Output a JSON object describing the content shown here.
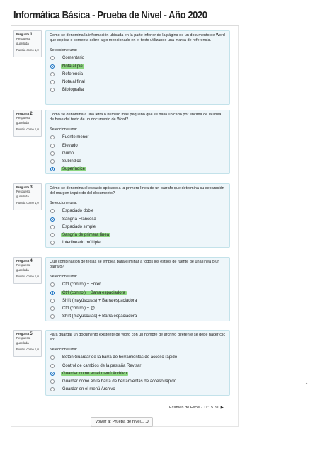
{
  "page": {
    "title": "Informática Básica - Prueba de Nivel - Año 2020"
  },
  "questions": [
    {
      "number_label": "Pregunta",
      "number": "1",
      "status": "Respuesta guardada",
      "score": "Puntúa como 1,0",
      "text": "Como se denomina la información ubicada en la parte inferior de la página de un documento de Word que explica o comenta sobre algo mencionado en el texto utilizando una marca de referencia.",
      "prompt": "Seleccione una:",
      "options": [
        "Comentario",
        "Nota al pie",
        "Referencia",
        "Nota al final",
        "Bibliografía"
      ],
      "selected_index": 1,
      "highlighted_index": 1
    },
    {
      "number_label": "Pregunta",
      "number": "2",
      "status": "Respuesta guardada",
      "score": "Puntúa como 1,0",
      "text": "Cómo se denomina a una letra o número más pequeño que se halla ubicado por encima de la línea de base del texto de un documento de Word?",
      "prompt": "Seleccione una:",
      "options": [
        "Fuente menor",
        "Elevado",
        "Guion",
        "Subíndice",
        "Superíndice"
      ],
      "selected_index": 4,
      "highlighted_index": 4
    },
    {
      "number_label": "Pregunta",
      "number": "3",
      "status": "Respuesta guardada",
      "score": "Puntúa como 1,0",
      "text": "Cómo se denomina el espacio aplicado a la primera línea de un párrafo que determina su separación del margen izquierdo del documento?",
      "prompt": "Seleccione una:",
      "options": [
        "Espaciado doble",
        "Sangría Francesa",
        "Espaciado simple",
        "Sangría de primera línea",
        "Interlineado múltiple"
      ],
      "selected_index": 1,
      "highlighted_index": 3
    },
    {
      "number_label": "Pregunta",
      "number": "4",
      "status": "Respuesta guardada",
      "score": "Puntúa como 1,0",
      "text": "Que combinación de teclas se emplea para eliminar a todos los estilos de fuente de una línea o un párrafo?",
      "prompt": "Seleccione una:",
      "options": [
        "Ctrl (control) + Enter",
        "Ctrl (control) + Barra espaciadora",
        "Shift (mayúsculas) + Barra espaciadora",
        "Ctrl (control) + @",
        "Shift (mayúsculas) + Barra espaciadora"
      ],
      "selected_index": 1,
      "highlighted_index": 1
    },
    {
      "number_label": "Pregunta",
      "number": "5",
      "status": "Respuesta guardada",
      "score": "Puntúa como 1,0",
      "text": "Para guardar un documento existente de Word con un nombre de archivo diferente se debe hacer clic en:",
      "prompt": "Seleccione una:",
      "options": [
        "Botón Guardar de la barra de herramientas de acceso rápido",
        "Control de cambios de la pestaña Revisar",
        "Guardar como en el menú Archivo",
        "Guardar como en la barra de herramientas de acceso rápido",
        "Guardar en el menú Archivo"
      ],
      "selected_index": 2,
      "highlighted_index": 2
    }
  ],
  "navigation": {
    "next_activity": "Examen de Excel - 11:15 hs. ▶",
    "back_button": "Volver a: Prueba de nivel... ⮊",
    "scroll_top_icon": "chevron-up-icon"
  }
}
